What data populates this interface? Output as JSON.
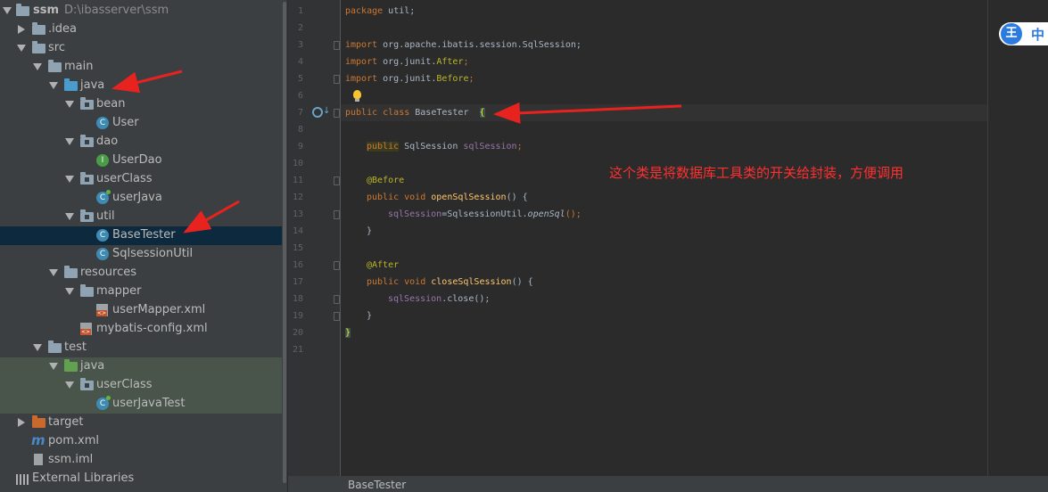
{
  "project_tree": {
    "items": [
      {
        "label": "ssm",
        "path": "D:\\ibasserver\\ssm"
      },
      {
        "label": ".idea"
      },
      {
        "label": "src"
      },
      {
        "label": "main"
      },
      {
        "label": "java"
      },
      {
        "label": "bean"
      },
      {
        "label": "User"
      },
      {
        "label": "dao"
      },
      {
        "label": "UserDao"
      },
      {
        "label": "userClass"
      },
      {
        "label": "userJava"
      },
      {
        "label": "util"
      },
      {
        "label": "BaseTester"
      },
      {
        "label": "SqlsessionUtil"
      },
      {
        "label": "resources"
      },
      {
        "label": "mapper"
      },
      {
        "label": "userMapper.xml"
      },
      {
        "label": "mybatis-config.xml"
      },
      {
        "label": "test"
      },
      {
        "label": "java"
      },
      {
        "label": "userClass"
      },
      {
        "label": "userJavaTest"
      },
      {
        "label": "target"
      },
      {
        "label": "pom.xml"
      },
      {
        "label": "ssm.iml"
      },
      {
        "label": "External Libraries"
      }
    ]
  },
  "editor": {
    "line_numbers": [
      "1",
      "2",
      "3",
      "4",
      "5",
      "6",
      "7",
      "8",
      "9",
      "10",
      "11",
      "12",
      "13",
      "14",
      "15",
      "16",
      "17",
      "18",
      "19",
      "20",
      "21"
    ],
    "code": {
      "l1_kw": "package",
      "l1_rest": " util;",
      "l3_kw": "import",
      "l3_rest": " org.apache.ibatis.session.SqlSession;",
      "l4_kw": "import",
      "l4_pkg": " org.junit.",
      "l4_cls": "After",
      "l4_end": ";",
      "l5_kw": "import",
      "l5_pkg": " org.junit.",
      "l5_cls": "Before",
      "l5_end": ";",
      "l7_kw": "public class",
      "l7_name": " BaseTester ",
      "l7_brace": "{",
      "l9_kw": "public",
      "l9_type": " SqlSession ",
      "l9_field": "sqlSession",
      "l9_end": ";",
      "l11_ann": "@Before",
      "l12_kw": "public void",
      "l12_name": "openSqlSession",
      "l12_rest": "() {",
      "l13_field": "sqlSession",
      "l13_mid": "=SqlsessionUtil.",
      "l13_call": "openSql",
      "l13_end": "();",
      "l14": "}",
      "l16_ann": "@After",
      "l17_kw": "public void",
      "l17_name": "closeSqlSession",
      "l17_rest": "() {",
      "l18_field": "sqlSession",
      "l18_rest": ".close();",
      "l19": "}",
      "l20": "}"
    }
  },
  "annotation_note": "这个类是将数据库工具类的开关给封装，方便调用",
  "status_bar": {
    "file": "BaseTester"
  },
  "ime": {
    "logo": "王",
    "mode": "中"
  },
  "colors": {
    "arrow": "#e8231f",
    "keyword": "#cc7832",
    "annotation": "#bbb529",
    "field": "#9876aa",
    "method": "#ffc66d"
  }
}
